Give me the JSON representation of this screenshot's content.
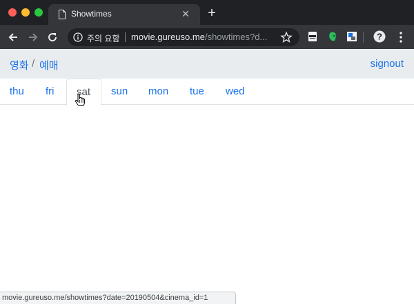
{
  "browser": {
    "tab_title": "Showtimes",
    "security_text": "주의 요함",
    "url_host": "movie.gureuso.me",
    "url_path": "/showtimes?d...",
    "status_url": "movie.gureuso.me/showtimes?date=20190504&cinema_id=1"
  },
  "site": {
    "breadcrumb": {
      "movie": "영화",
      "sep": "/",
      "booking": "예매"
    },
    "signout": "signout",
    "days": [
      {
        "label": "thu"
      },
      {
        "label": "fri"
      },
      {
        "label": "sat",
        "active": true
      },
      {
        "label": "sun"
      },
      {
        "label": "mon"
      },
      {
        "label": "tue"
      },
      {
        "label": "wed"
      }
    ]
  }
}
